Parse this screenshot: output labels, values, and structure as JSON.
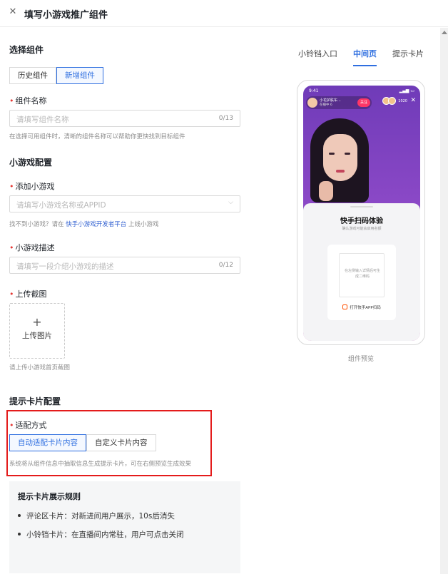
{
  "header": {
    "close_icon": "close-icon",
    "title": "填写小游戏推广组件"
  },
  "select_component": {
    "title": "选择组件",
    "options": [
      {
        "label": "历史组件"
      },
      {
        "label": "新增组件"
      }
    ],
    "selected": "新增组件"
  },
  "component_name": {
    "label": "组件名称",
    "placeholder": "请填写组件名称",
    "count": "0/13",
    "help": "在选择可用组件时，清晰的组件名称可以帮助你更快找到目标组件"
  },
  "game_config": {
    "title": "小游戏配置",
    "add_game": {
      "label": "添加小游戏",
      "placeholder": "请填写小游戏名称或APPID",
      "help_prefix": "找不到小游戏？请在",
      "help_link": "快手小游戏开发者平台",
      "help_suffix": "上线小游戏"
    },
    "description": {
      "label": "小游戏描述",
      "placeholder": "请填写一段介绍小游戏的描述",
      "count": "0/12"
    },
    "screenshot": {
      "label": "上传截图",
      "upload_label": "上传图片",
      "help": "请上传小游戏首页截图"
    }
  },
  "tip_card_config": {
    "title": "提示卡片配置",
    "adapt": {
      "label": "适配方式",
      "options": [
        {
          "label": "自动适配卡片内容"
        },
        {
          "label": "自定义卡片内容"
        }
      ],
      "selected": "自动适配卡片内容",
      "help": "系统将从组件信息中抽取信息生成提示卡片，可在右侧预览生成效果"
    },
    "rules": {
      "title": "提示卡片展示规则",
      "items": [
        {
          "text": "评论区卡片：对新进间用户展示，10s后消失"
        },
        {
          "text": "小铃铛卡片：在直播间内常驻，用户可点击关闭"
        }
      ]
    }
  },
  "preview": {
    "tabs": [
      {
        "label": "小铃铛入口"
      },
      {
        "label": "中间页"
      },
      {
        "label": "提示卡片"
      }
    ],
    "active_tab": "中间页",
    "phone": {
      "time": "9:41",
      "streamer_name": "小花护肤车...",
      "streamer_sub": "在播中 6",
      "follow_label": "关注",
      "viewer_count": "1020",
      "sheet_title": "快手扫码体验",
      "sheet_subtitle": "确认游戏可能会启用名额",
      "qr_hint": "在左侧输入详情后可生成二维码",
      "scan_label": "打开快手APP扫码"
    },
    "label": "组件预览"
  }
}
